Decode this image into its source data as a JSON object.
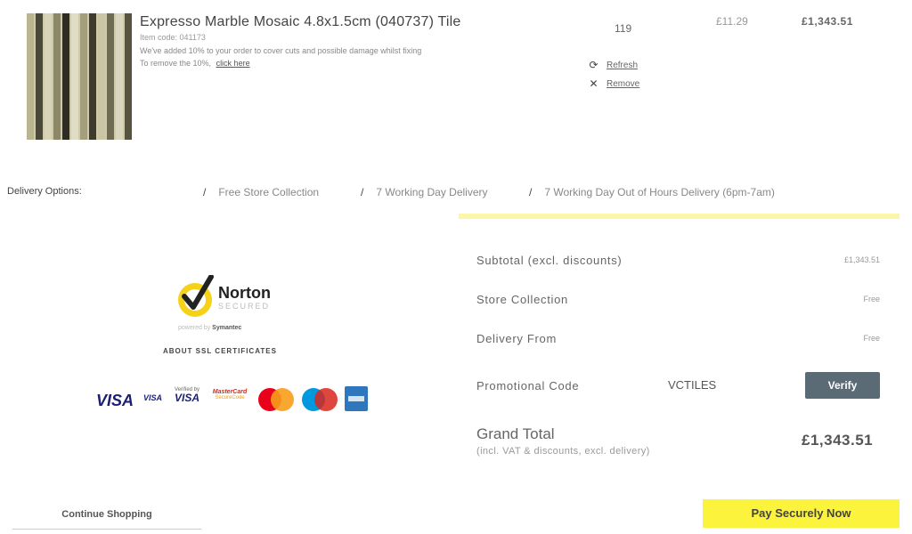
{
  "product": {
    "title": "Expresso Marble Mosaic 4.8x1.5cm (040737) Tile",
    "item_code": "Item code: 041173",
    "waste_note": "We've added 10% to your order to cover cuts and possible damage whilst fixing",
    "remove_text": "To remove the 10%,",
    "remove_link": "click here",
    "quantity": "119",
    "unit_price": "£11.29",
    "line_total": "£1,343.51",
    "refresh_label": "Refresh",
    "remove_label": "Remove"
  },
  "delivery": {
    "label": "Delivery Options:",
    "options": [
      "Free Store Collection",
      "7 Working Day Delivery",
      "7 Working Day Out of Hours Delivery (6pm-7am)"
    ]
  },
  "summary": {
    "subtotal_label": "Subtotal (excl. discounts)",
    "subtotal_value": "£1,343.51",
    "store_label": "Store Collection",
    "store_value": "Free",
    "delivery_label": "Delivery From",
    "delivery_value": "Free",
    "promo_label": "Promotional Code",
    "promo_code": "VCTILES",
    "verify_label": "Verify",
    "grand_label": "Grand Total",
    "grand_sub": "(incl. VAT & discounts, excl. delivery)",
    "grand_value": "£1,343.51"
  },
  "trust": {
    "norton": "Norton",
    "secured": "SECURED",
    "powered_prefix": "powered by",
    "powered_brand": "Symantec",
    "ssl": "ABOUT SSL CERTIFICATES",
    "verified_by": "Verified by",
    "visa": "VISA",
    "mastercard_top": "MasterCard",
    "mastercard_bottom": "SecureCode"
  },
  "actions": {
    "continue": "Continue Shopping",
    "pay": "Pay Securely Now"
  },
  "colors": {
    "accent_yellow": "#fcf33c",
    "rule_yellow": "#fbf6a8",
    "verify_bg": "#5b6b76"
  }
}
